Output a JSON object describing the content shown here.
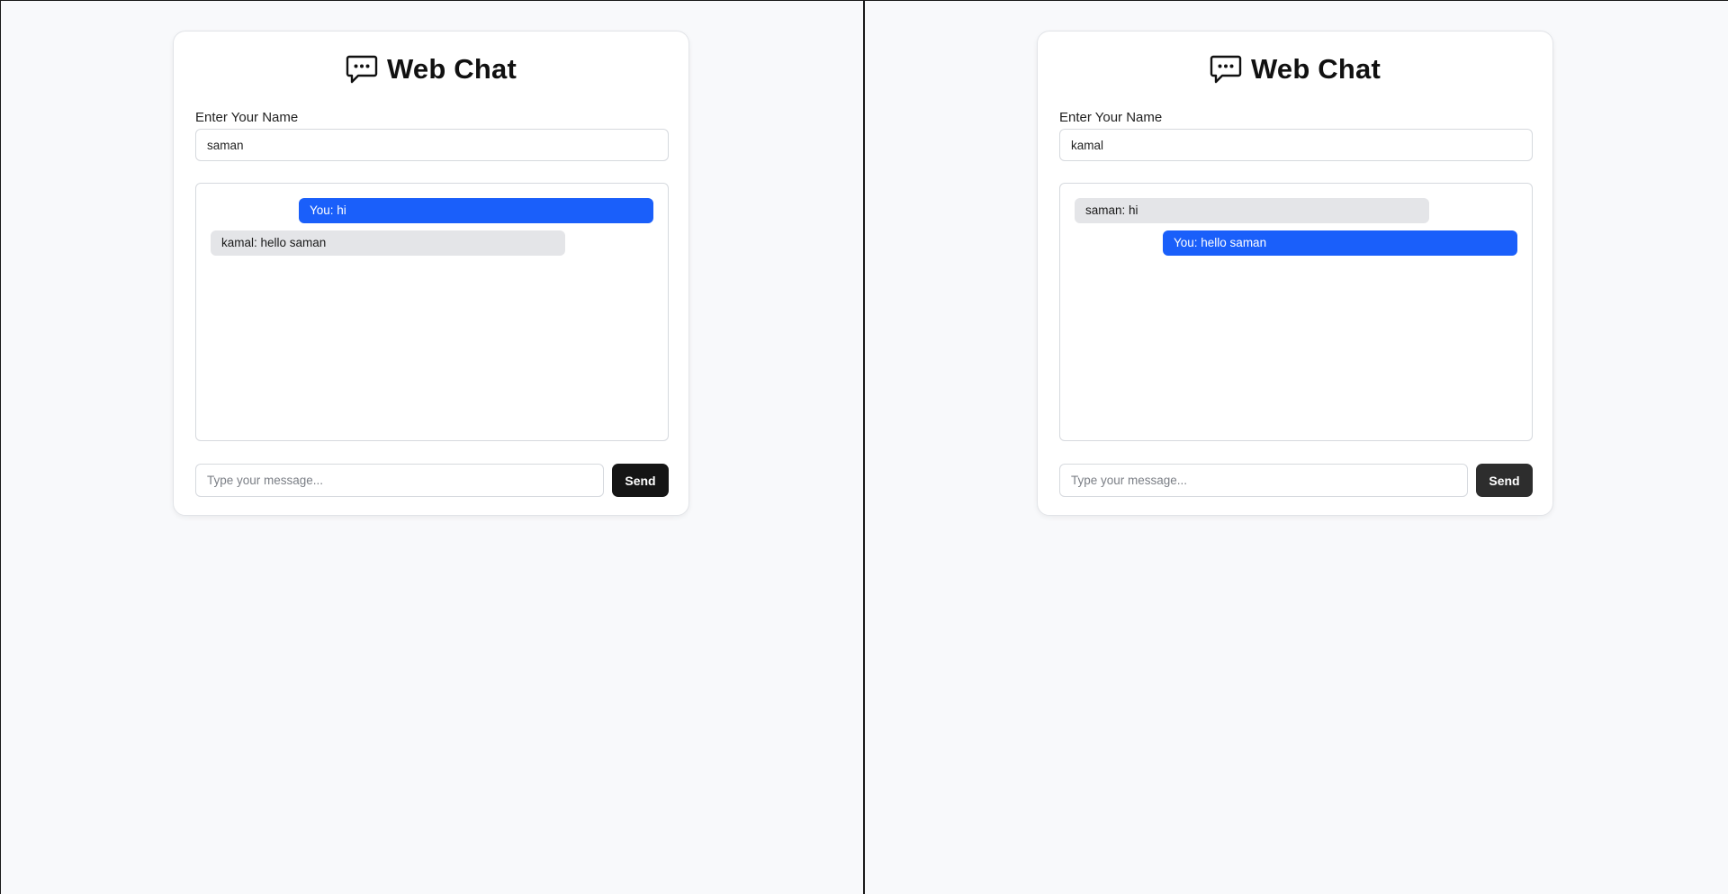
{
  "app": {
    "title": "Web Chat",
    "icon": "chat-bubble-icon"
  },
  "panes": [
    {
      "name_label": "Enter Your Name",
      "name_value": "saman",
      "messages": [
        {
          "from": "self",
          "text": "You: hi"
        },
        {
          "from": "other",
          "text": "kamal: hello saman"
        }
      ],
      "message_placeholder": "Type your message...",
      "send_label": "Send"
    },
    {
      "name_label": "Enter Your Name",
      "name_value": "kamal",
      "messages": [
        {
          "from": "other",
          "text": "saman: hi"
        },
        {
          "from": "self",
          "text": "You: hello saman"
        }
      ],
      "message_placeholder": "Type your message...",
      "send_label": "Send"
    }
  ],
  "colors": {
    "page_background": "#f8f9fb",
    "own_message": "#1a5ffa",
    "other_message": "#e4e5e8",
    "send_button": "#151515",
    "window_divider": "#1a1a1a"
  }
}
